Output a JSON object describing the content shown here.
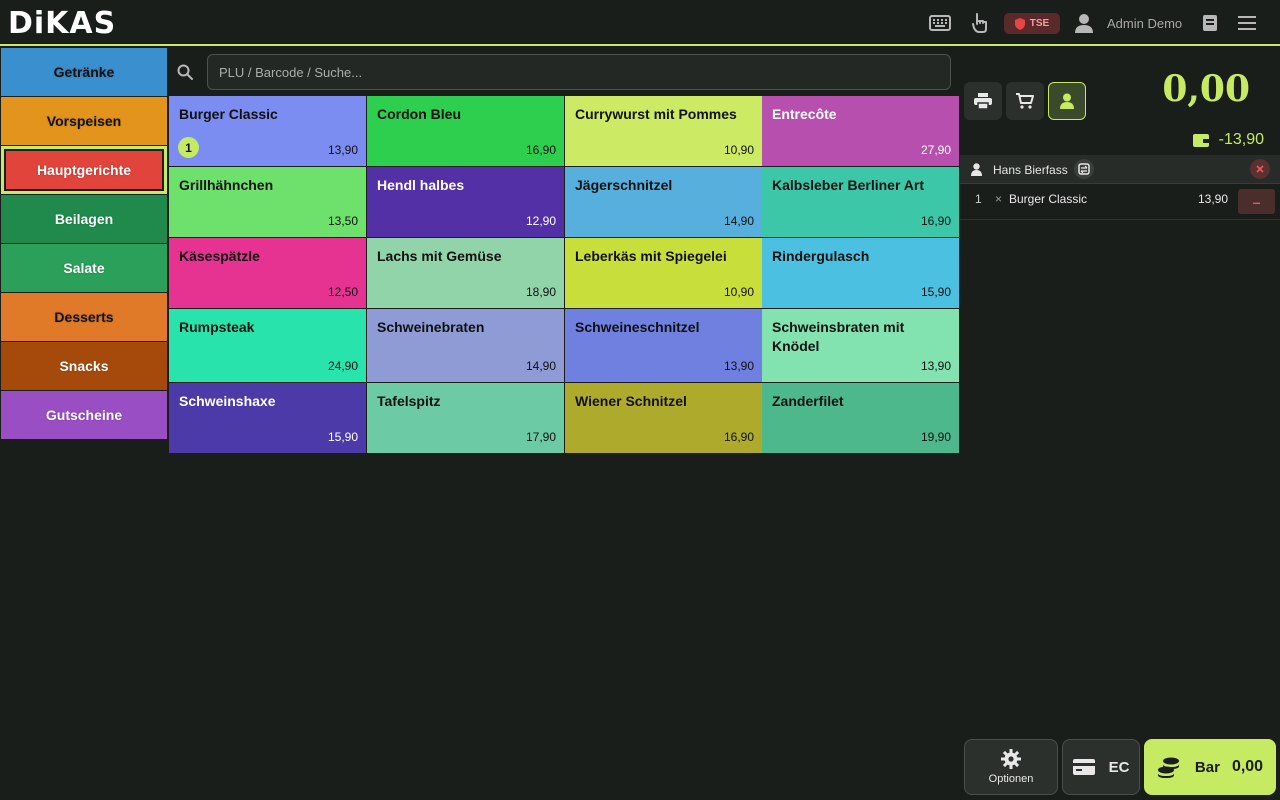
{
  "app": {
    "logo_text": "DiKAS",
    "tse_label": "TSE",
    "user_name": "Admin Demo"
  },
  "icons": {
    "keyboard": "keyboard-icon",
    "touch": "hand-pointer-icon",
    "tse": "shield-icon",
    "user": "user-icon",
    "journal": "book-icon",
    "menu": "hamburger-menu-icon",
    "search": "search-icon",
    "printer": "printer-icon",
    "cart": "cart-icon",
    "customer": "person-icon",
    "wallet": "wallet-icon",
    "swap": "swap-icon",
    "close": "close-icon",
    "settings": "gear-icon",
    "card": "credit-card-icon",
    "coins": "coins-icon"
  },
  "categories": [
    {
      "label": "Getränke",
      "bg": "#3a8fcf",
      "fg": "#111111"
    },
    {
      "label": "Vorspeisen",
      "bg": "#e3941c",
      "fg": "#111111"
    },
    {
      "label": "Hauptgerichte",
      "bg": "#e0443a",
      "fg": "#ffffff",
      "active": true
    },
    {
      "label": "Beilagen",
      "bg": "#1f8a4c",
      "fg": "#ffffff"
    },
    {
      "label": "Salate",
      "bg": "#2aa05b",
      "fg": "#ffffff"
    },
    {
      "label": "Desserts",
      "bg": "#e07a28",
      "fg": "#111111"
    },
    {
      "label": "Snacks",
      "bg": "#a64a0c",
      "fg": "#ffffff"
    },
    {
      "label": "Gutscheine",
      "bg": "#9a4ec4",
      "fg": "#ffffff"
    }
  ],
  "search": {
    "placeholder": "PLU / Barcode / Suche..."
  },
  "products": [
    {
      "name": "Burger Classic",
      "price": "13,90",
      "bg": "#7b8df0",
      "fg": "#111111",
      "qty": "1"
    },
    {
      "name": "Cordon Bleu",
      "price": "16,90",
      "bg": "#2ecf4f",
      "fg": "#111111"
    },
    {
      "name": "Currywurst mit Pommes",
      "price": "10,90",
      "bg": "#cdea64",
      "fg": "#111111"
    },
    {
      "name": "Entrecôte",
      "price": "27,90",
      "bg": "#b64fae",
      "fg": "#ffffff"
    },
    {
      "name": "Grillhähnchen",
      "price": "13,50",
      "bg": "#6ee06c",
      "fg": "#111111"
    },
    {
      "name": "Hendl halbes",
      "price": "12,90",
      "bg": "#5430a6",
      "fg": "#ffffff"
    },
    {
      "name": "Jägerschnitzel",
      "price": "14,90",
      "bg": "#56afdc",
      "fg": "#111111"
    },
    {
      "name": "Kalbsleber Berliner Art",
      "price": "16,90",
      "bg": "#3cc8a8",
      "fg": "#111111"
    },
    {
      "name": "Käsespätzle",
      "price": "12,50",
      "bg": "#e63392",
      "fg": "#111111"
    },
    {
      "name": "Lachs mit Gemüse",
      "price": "18,90",
      "bg": "#92d4aa",
      "fg": "#111111"
    },
    {
      "name": "Leberkäs mit Spiegelei",
      "price": "10,90",
      "bg": "#c8de3a",
      "fg": "#111111"
    },
    {
      "name": "Rindergulasch",
      "price": "15,90",
      "bg": "#4cc0e0",
      "fg": "#111111"
    },
    {
      "name": "Rumpsteak",
      "price": "24,90",
      "bg": "#28e3ac",
      "fg": "#111111"
    },
    {
      "name": "Schweinebraten",
      "price": "14,90",
      "bg": "#8e9bd4",
      "fg": "#111111"
    },
    {
      "name": "Schweineschnitzel",
      "price": "13,90",
      "bg": "#7080e0",
      "fg": "#111111"
    },
    {
      "name": "Schweinsbraten mit Knödel",
      "price": "13,90",
      "bg": "#82e2b0",
      "fg": "#111111"
    },
    {
      "name": "Schweinshaxe",
      "price": "15,90",
      "bg": "#4c3aa8",
      "fg": "#ffffff"
    },
    {
      "name": "Tafelspitz",
      "price": "17,90",
      "bg": "#6ccaa4",
      "fg": "#111111"
    },
    {
      "name": "Wiener Schnitzel",
      "price": "16,90",
      "bg": "#aeaa2c",
      "fg": "#111111"
    },
    {
      "name": "Zanderfilet",
      "price": "19,90",
      "bg": "#4cb88c",
      "fg": "#111111"
    }
  ],
  "order": {
    "total": "0,00",
    "balance": "-13,90",
    "customer_name": "Hans Bierfass",
    "items": [
      {
        "qty": "1",
        "times": "×",
        "name": "Burger Classic",
        "price": "13,90",
        "remove": "–"
      }
    ]
  },
  "actions": {
    "options_label": "Optionen",
    "ec_label": "EC",
    "cash_label": "Bar",
    "cash_amount": "0,00"
  },
  "colors": {
    "accent": "#c6ea62",
    "background": "#1a1e1b",
    "panel": "#2b302c"
  }
}
